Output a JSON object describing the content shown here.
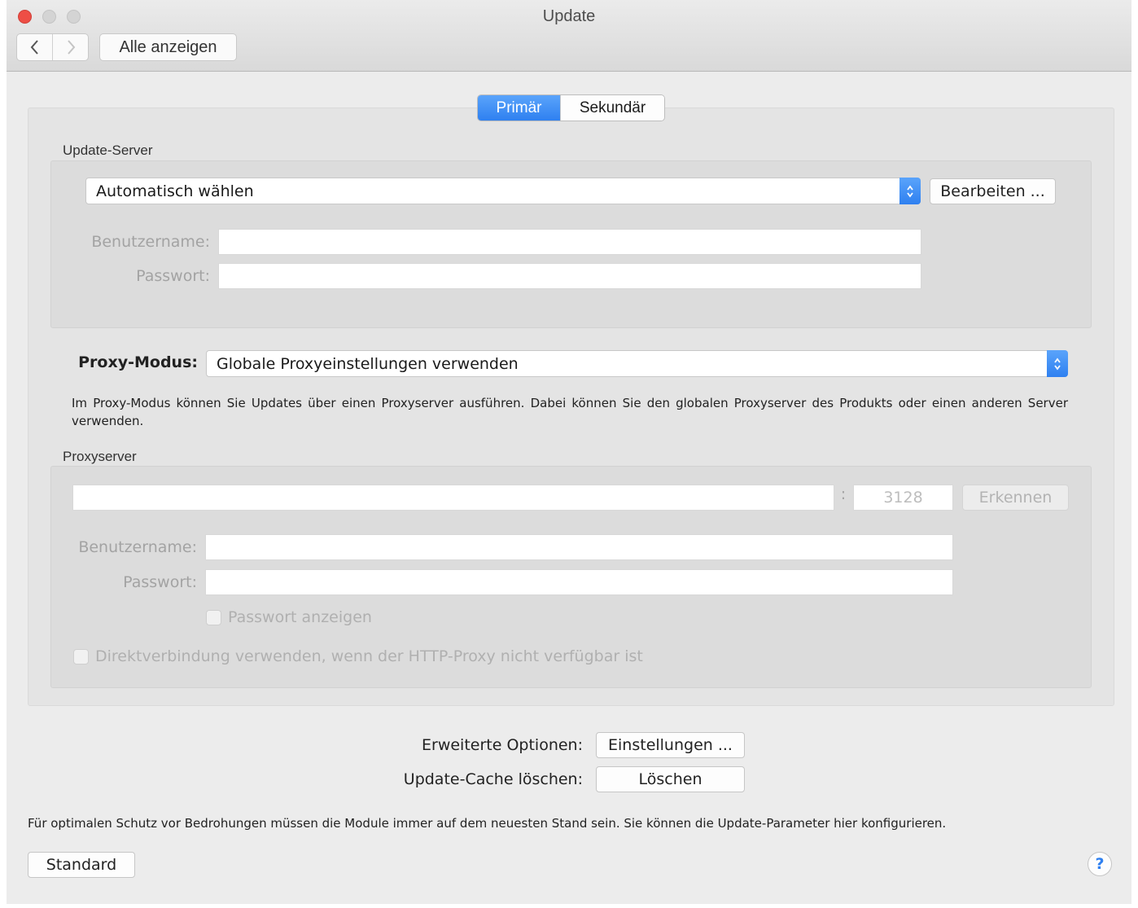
{
  "window": {
    "title": "Update"
  },
  "toolbar": {
    "back_icon": "chevron-left-icon",
    "forward_icon": "chevron-right-icon",
    "show_all_label": "Alle anzeigen"
  },
  "tabs": [
    {
      "label": "Primär",
      "active": true
    },
    {
      "label": "Sekundär",
      "active": false
    }
  ],
  "update_server": {
    "section_label": "Update-Server",
    "server_select": "Automatisch wählen",
    "edit_button": "Bearbeiten ...",
    "username_label": "Benutzername:",
    "username_value": "",
    "password_label": "Passwort:",
    "password_value": ""
  },
  "proxy": {
    "mode_label": "Proxy-Modus:",
    "mode_select": "Globale Proxyeinstellungen verwenden",
    "description": "Im Proxy-Modus können Sie Updates über einen Proxyserver ausführen. Dabei können Sie den globalen Proxyserver des Produkts oder einen anderen Server verwenden.",
    "server_section_label": "Proxyserver",
    "host_value": "",
    "port_separator": ":",
    "port_placeholder": "3128",
    "detect_button": "Erkennen",
    "username_label": "Benutzername:",
    "password_label": "Passwort:",
    "show_password_label": "Passwort anzeigen",
    "direct_connection_label": "Direktverbindung verwenden, wenn der HTTP-Proxy nicht verfügbar ist"
  },
  "advanced": {
    "options_label": "Erweiterte Optionen:",
    "settings_button": "Einstellungen ...",
    "cache_label": "Update-Cache löschen:",
    "delete_button": "Löschen"
  },
  "footer": {
    "info_text": "Für optimalen Schutz vor Bedrohungen müssen die Module immer auf dem neuesten Stand sein. Sie können die Update-Parameter hier konfigurieren.",
    "standard_button": "Standard",
    "help_label": "?"
  },
  "colors": {
    "accent": "#2f80f0",
    "close": "#ee4e45",
    "disabled_text": "#a3a3a3"
  }
}
